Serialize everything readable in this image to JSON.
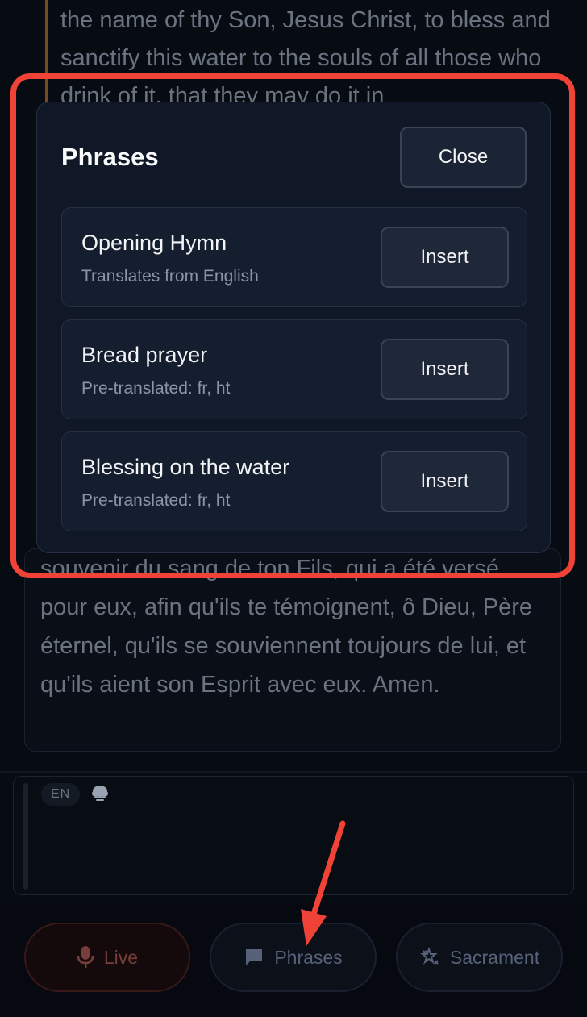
{
  "transcript": {
    "english_text": "the name of thy Son, Jesus Christ, to bless and sanctify this water to the souls of all those who drink of it, that they may do it in",
    "french_text": "souvenir du sang de ton Fils, qui a été versé pour eux, afin qu'ils te témoignent, ô Dieu, Père éternel, qu'ils se souviennent toujours de lui, et qu'ils aient son Esprit avec eux. Amen."
  },
  "input": {
    "language_chip": "EN",
    "cloud_icon": "cloud-icon"
  },
  "phrases_modal": {
    "title": "Phrases",
    "close_label": "Close",
    "items": [
      {
        "title": "Opening Hymn",
        "subtitle": "Translates from English",
        "action_label": "Insert"
      },
      {
        "title": "Bread prayer",
        "subtitle": "Pre-translated: fr, ht",
        "action_label": "Insert"
      },
      {
        "title": "Blessing on the water",
        "subtitle": "Pre-translated: fr, ht",
        "action_label": "Insert"
      }
    ]
  },
  "bottom_nav": {
    "live": {
      "label": "Live",
      "icon": "microphone-icon"
    },
    "phrases": {
      "label": "Phrases",
      "icon": "chat-bubble-icon"
    },
    "sacrament": {
      "label": "Sacrament",
      "icon": "sacrament-icon"
    }
  },
  "colors": {
    "highlight": "#f04236",
    "modal_bg": "#101828",
    "page_bg": "#070b12"
  }
}
